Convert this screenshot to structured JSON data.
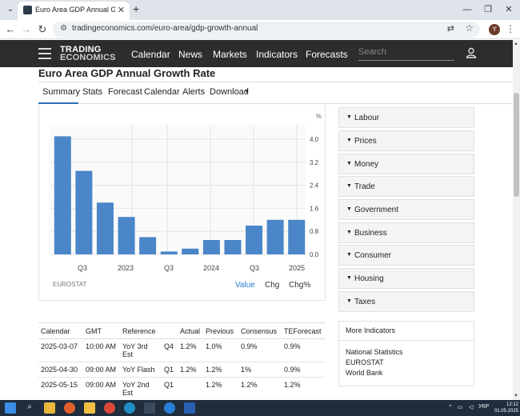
{
  "browser": {
    "tab_title": "Euro Area GDP Annual Growth Ra",
    "url": "tradingeconomics.com/euro-area/gdp-growth-annual",
    "profile_initial": "Y"
  },
  "site": {
    "logo_line1": "TRADING",
    "logo_line2": "ECONOMICS",
    "nav": [
      "Calendar",
      "News",
      "Markets",
      "Indicators",
      "Forecasts"
    ],
    "search_placeholder": "Search"
  },
  "page": {
    "title": "Euro Area GDP Annual Growth Rate",
    "tabs": [
      "Summary",
      "Stats",
      "Forecast",
      "Calendar",
      "Alerts",
      "Download"
    ]
  },
  "chart_data": {
    "type": "bar",
    "values": [
      4.1,
      2.9,
      1.8,
      1.3,
      0.6,
      0.1,
      0.2,
      0.5,
      0.5,
      1.0,
      1.2,
      1.2
    ],
    "x_tick_labels": [
      "Q3",
      "2023",
      "Q3",
      "2024",
      "Q3",
      "2025"
    ],
    "y_ticks": [
      "4.0",
      "3.2",
      "2.4",
      "1.6",
      "0.8",
      "0.0"
    ],
    "y_unit": "%",
    "ylim": [
      0,
      4.5
    ],
    "grid": true,
    "color": "#4a86c8",
    "source": "EUROSTAT",
    "options": [
      "Value",
      "Chg",
      "Chg%"
    ],
    "active_option": "Value"
  },
  "sidebar": {
    "items": [
      "Labour",
      "Prices",
      "Money",
      "Trade",
      "Government",
      "Business",
      "Consumer",
      "Housing",
      "Taxes"
    ],
    "more_title": "More Indicators",
    "more_links": [
      "National Statistics",
      "EUROSTAT",
      "World Bank"
    ]
  },
  "calendar": {
    "headers": [
      "Calendar",
      "GMT",
      "Reference",
      "",
      "Actual",
      "Previous",
      "Consensus",
      "TEForecast"
    ],
    "rows": [
      [
        "2025-03-07",
        "10:00 AM",
        "YoY 3rd Est",
        "Q4",
        "1.2%",
        "1.0%",
        "0.9%",
        "0.9%"
      ],
      [
        "2025-04-30",
        "09:00 AM",
        "YoY Flash",
        "Q1",
        "1.2%",
        "1.2%",
        "1%",
        "0.9%"
      ],
      [
        "2025-05-15",
        "09:00 AM",
        "YoY 2nd Est",
        "Q1",
        "",
        "1.2%",
        "1.2%",
        "1.2%"
      ]
    ]
  },
  "taskbar": {
    "lang": "УКР",
    "time": "12:12",
    "date": "01.05.2025"
  }
}
